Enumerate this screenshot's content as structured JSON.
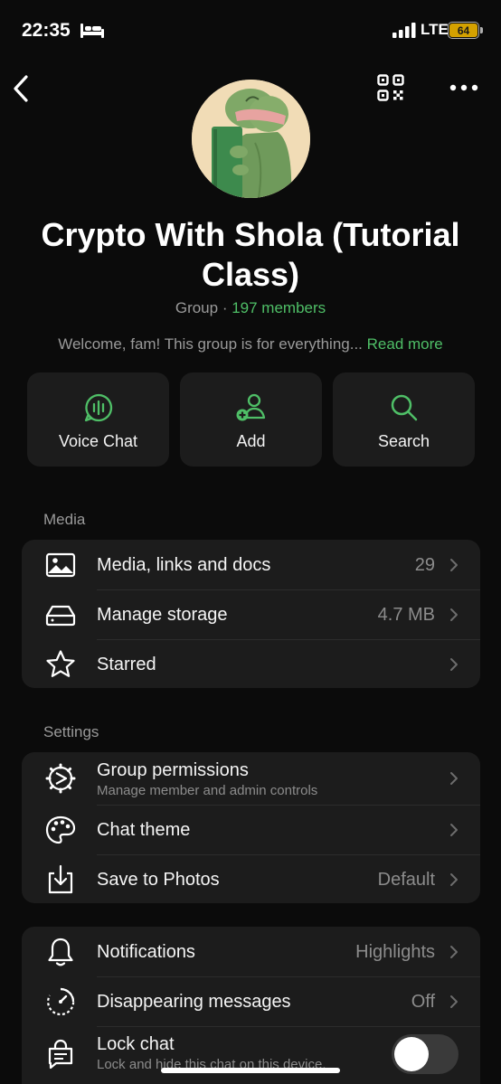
{
  "status": {
    "time": "22:35",
    "network": "LTE",
    "battery": "64"
  },
  "header": {
    "title": "Crypto With Shola (Tutorial Class)",
    "meta_type": "Group",
    "meta_separator": " · ",
    "members": "197 members",
    "description": "Welcome, fam! This group is for everything... ",
    "read_more": "Read more"
  },
  "actions": [
    {
      "label": "Voice Chat",
      "icon": "voice-chat-icon"
    },
    {
      "label": "Add",
      "icon": "add-member-icon"
    },
    {
      "label": "Search",
      "icon": "search-icon"
    }
  ],
  "media": {
    "header": "Media",
    "rows": [
      {
        "label": "Media, links and docs",
        "value": "29",
        "icon": "image-icon"
      },
      {
        "label": "Manage storage",
        "value": "4.7 MB",
        "icon": "storage-icon"
      },
      {
        "label": "Starred",
        "value": "",
        "icon": "star-icon"
      }
    ]
  },
  "settings": {
    "header": "Settings",
    "rows": [
      {
        "label": "Group permissions",
        "sub": "Manage member and admin controls",
        "icon": "gear-icon"
      },
      {
        "label": "Chat theme",
        "icon": "palette-icon"
      },
      {
        "label": "Save to Photos",
        "value": "Default",
        "icon": "save-icon"
      }
    ]
  },
  "privacy": {
    "rows": [
      {
        "label": "Notifications",
        "value": "Highlights",
        "icon": "bell-icon"
      },
      {
        "label": "Disappearing messages",
        "value": "Off",
        "icon": "timer-icon"
      },
      {
        "label": "Lock chat",
        "sub": "Lock and hide this chat on this device.",
        "icon": "lock-chat-icon",
        "toggle_on": false
      }
    ]
  },
  "colors": {
    "accent": "#4fbf67",
    "background": "#0b0b0b",
    "card": "#1c1c1c"
  }
}
